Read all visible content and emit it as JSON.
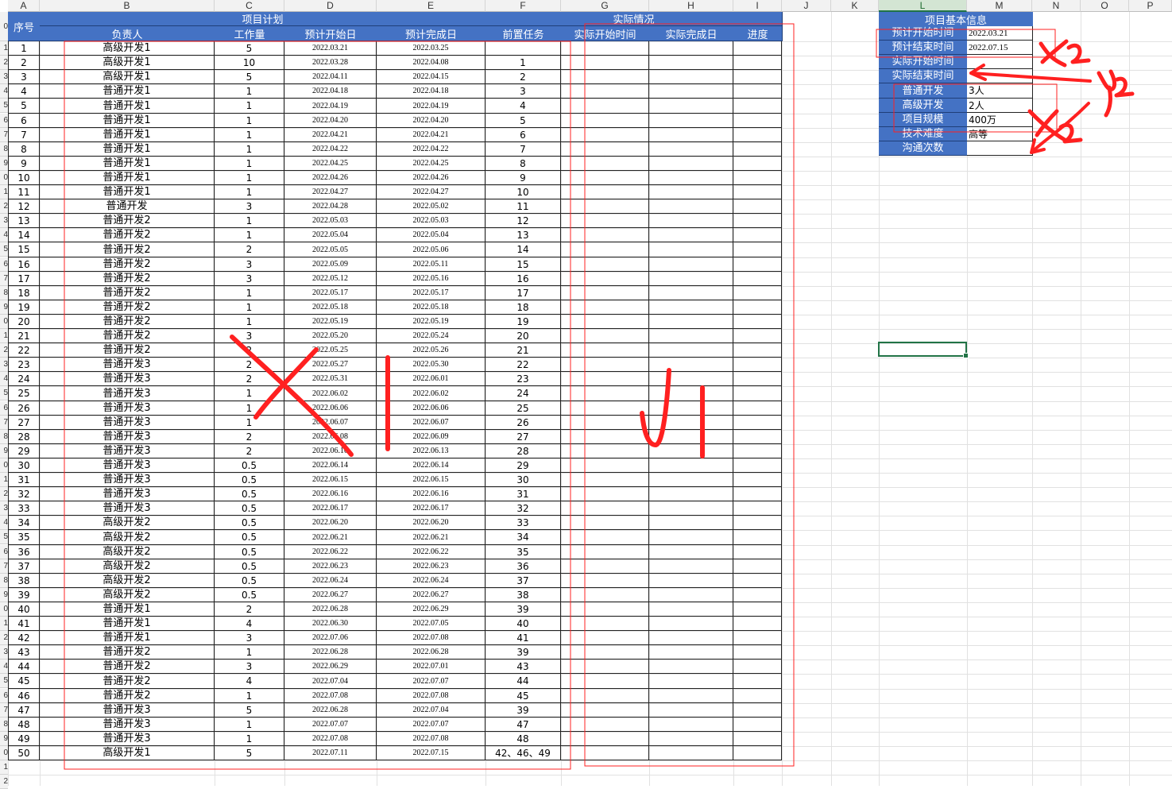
{
  "column_letters": [
    "A",
    "B",
    "C",
    "D",
    "E",
    "F",
    "G",
    "H",
    "I",
    "J",
    "K",
    "L",
    "M",
    "N",
    "O",
    "P"
  ],
  "row_numbers_visible": [
    "0",
    "1",
    "2",
    "3",
    "4",
    "5",
    "6",
    "7",
    "8",
    "9",
    "0",
    "1",
    "2",
    "3",
    "4",
    "5",
    "6",
    "7",
    "8",
    "9",
    "0",
    "1",
    "2",
    "3",
    "4",
    "5",
    "6",
    "7",
    "8",
    "9",
    "0",
    "1",
    "2",
    "3",
    "4",
    "5",
    "6",
    "7",
    "8",
    "9",
    "0",
    "1",
    "2",
    "3",
    "4",
    "5",
    "6",
    "7",
    "8",
    "9",
    "0",
    "1",
    "2"
  ],
  "table_header": {
    "seq": "序号",
    "plan_group": "项目计划",
    "actual_group": "实际情况",
    "owner": "负责人",
    "effort": "工作量",
    "plan_start": "预计开始日",
    "plan_end": "预计完成日",
    "prereq": "前置任务",
    "actual_start": "实际开始时间",
    "actual_end": "实际完成日",
    "progress": "进度"
  },
  "rows": [
    [
      "1",
      "高级开发1",
      "5",
      "2022.03.21",
      "2022.03.25",
      ""
    ],
    [
      "2",
      "高级开发1",
      "10",
      "2022.03.28",
      "2022.04.08",
      "1"
    ],
    [
      "3",
      "高级开发1",
      "5",
      "2022.04.11",
      "2022.04.15",
      "2"
    ],
    [
      "4",
      "普通开发1",
      "1",
      "2022.04.18",
      "2022.04.18",
      "3"
    ],
    [
      "5",
      "普通开发1",
      "1",
      "2022.04.19",
      "2022.04.19",
      "4"
    ],
    [
      "6",
      "普通开发1",
      "1",
      "2022.04.20",
      "2022.04.20",
      "5"
    ],
    [
      "7",
      "普通开发1",
      "1",
      "2022.04.21",
      "2022.04.21",
      "6"
    ],
    [
      "8",
      "普通开发1",
      "1",
      "2022.04.22",
      "2022.04.22",
      "7"
    ],
    [
      "9",
      "普通开发1",
      "1",
      "2022.04.25",
      "2022.04.25",
      "8"
    ],
    [
      "10",
      "普通开发1",
      "1",
      "2022.04.26",
      "2022.04.26",
      "9"
    ],
    [
      "11",
      "普通开发1",
      "1",
      "2022.04.27",
      "2022.04.27",
      "10"
    ],
    [
      "12",
      "普通开发",
      "3",
      "2022.04.28",
      "2022.05.02",
      "11"
    ],
    [
      "13",
      "普通开发2",
      "1",
      "2022.05.03",
      "2022.05.03",
      "12"
    ],
    [
      "14",
      "普通开发2",
      "1",
      "2022.05.04",
      "2022.05.04",
      "13"
    ],
    [
      "15",
      "普通开发2",
      "2",
      "2022.05.05",
      "2022.05.06",
      "14"
    ],
    [
      "16",
      "普通开发2",
      "3",
      "2022.05.09",
      "2022.05.11",
      "15"
    ],
    [
      "17",
      "普通开发2",
      "3",
      "2022.05.12",
      "2022.05.16",
      "16"
    ],
    [
      "18",
      "普通开发2",
      "1",
      "2022.05.17",
      "2022.05.17",
      "17"
    ],
    [
      "19",
      "普通开发2",
      "1",
      "2022.05.18",
      "2022.05.18",
      "18"
    ],
    [
      "20",
      "普通开发2",
      "1",
      "2022.05.19",
      "2022.05.19",
      "19"
    ],
    [
      "21",
      "普通开发2",
      "3",
      "2022.05.20",
      "2022.05.24",
      "20"
    ],
    [
      "22",
      "普通开发2",
      "2",
      "2022.05.25",
      "2022.05.26",
      "21"
    ],
    [
      "23",
      "普通开发3",
      "2",
      "2022.05.27",
      "2022.05.30",
      "22"
    ],
    [
      "24",
      "普通开发3",
      "2",
      "2022.05.31",
      "2022.06.01",
      "23"
    ],
    [
      "25",
      "普通开发3",
      "1",
      "2022.06.02",
      "2022.06.02",
      "24"
    ],
    [
      "26",
      "普通开发3",
      "1",
      "2022.06.06",
      "2022.06.06",
      "25"
    ],
    [
      "27",
      "普通开发3",
      "1",
      "2022.06.07",
      "2022.06.07",
      "26"
    ],
    [
      "28",
      "普通开发3",
      "2",
      "2022.06.08",
      "2022.06.09",
      "27"
    ],
    [
      "29",
      "普通开发3",
      "2",
      "2022.06.10",
      "2022.06.13",
      "28"
    ],
    [
      "30",
      "普通开发3",
      "0.5",
      "2022.06.14",
      "2022.06.14",
      "29"
    ],
    [
      "31",
      "普通开发3",
      "0.5",
      "2022.06.15",
      "2022.06.15",
      "30"
    ],
    [
      "32",
      "普通开发3",
      "0.5",
      "2022.06.16",
      "2022.06.16",
      "31"
    ],
    [
      "33",
      "普通开发3",
      "0.5",
      "2022.06.17",
      "2022.06.17",
      "32"
    ],
    [
      "34",
      "高级开发2",
      "0.5",
      "2022.06.20",
      "2022.06.20",
      "33"
    ],
    [
      "35",
      "高级开发2",
      "0.5",
      "2022.06.21",
      "2022.06.21",
      "34"
    ],
    [
      "36",
      "高级开发2",
      "0.5",
      "2022.06.22",
      "2022.06.22",
      "35"
    ],
    [
      "37",
      "高级开发2",
      "0.5",
      "2022.06.23",
      "2022.06.23",
      "36"
    ],
    [
      "38",
      "高级开发2",
      "0.5",
      "2022.06.24",
      "2022.06.24",
      "37"
    ],
    [
      "39",
      "高级开发2",
      "0.5",
      "2022.06.27",
      "2022.06.27",
      "38"
    ],
    [
      "40",
      "普通开发1",
      "2",
      "2022.06.28",
      "2022.06.29",
      "39"
    ],
    [
      "41",
      "普通开发1",
      "4",
      "2022.06.30",
      "2022.07.05",
      "40"
    ],
    [
      "42",
      "普通开发1",
      "3",
      "2022.07.06",
      "2022.07.08",
      "41"
    ],
    [
      "43",
      "普通开发2",
      "1",
      "2022.06.28",
      "2022.06.28",
      "39"
    ],
    [
      "44",
      "普通开发2",
      "3",
      "2022.06.29",
      "2022.07.01",
      "43"
    ],
    [
      "45",
      "普通开发2",
      "4",
      "2022.07.04",
      "2022.07.07",
      "44"
    ],
    [
      "46",
      "普通开发2",
      "1",
      "2022.07.08",
      "2022.07.08",
      "45"
    ],
    [
      "47",
      "普通开发3",
      "5",
      "2022.06.28",
      "2022.07.04",
      "39"
    ],
    [
      "48",
      "普通开发3",
      "1",
      "2022.07.07",
      "2022.07.07",
      "47"
    ],
    [
      "49",
      "普通开发3",
      "1",
      "2022.07.08",
      "2022.07.08",
      "48"
    ],
    [
      "50",
      "高级开发1",
      "5",
      "2022.07.11",
      "2022.07.15",
      "42、46、49"
    ]
  ],
  "info_panel": {
    "title": "项目基本信息",
    "items": [
      {
        "label": "预计开始时间",
        "value": "2022.03.21"
      },
      {
        "label": "预计结束时间",
        "value": "2022.07.15"
      },
      {
        "label": "实际开始时间",
        "value": ""
      },
      {
        "label": "实际结束时间",
        "value": ""
      },
      {
        "label": "普通开发",
        "value": "3人"
      },
      {
        "label": "高级开发",
        "value": "2人"
      },
      {
        "label": "项目规模",
        "value": "400万"
      },
      {
        "label": "技术难度",
        "value": "高等"
      },
      {
        "label": "沟通次数",
        "value": ""
      }
    ]
  },
  "annotations": {
    "x1_label": "X1",
    "y1_label": "y1",
    "x2_label": "X2",
    "y2_label": "y2",
    "x3_label": "X2",
    "ink_color": "#ff2020"
  },
  "colors": {
    "header_blue": "#4472c4",
    "grid": "#e1e1e1",
    "selection_green": "#217346"
  }
}
